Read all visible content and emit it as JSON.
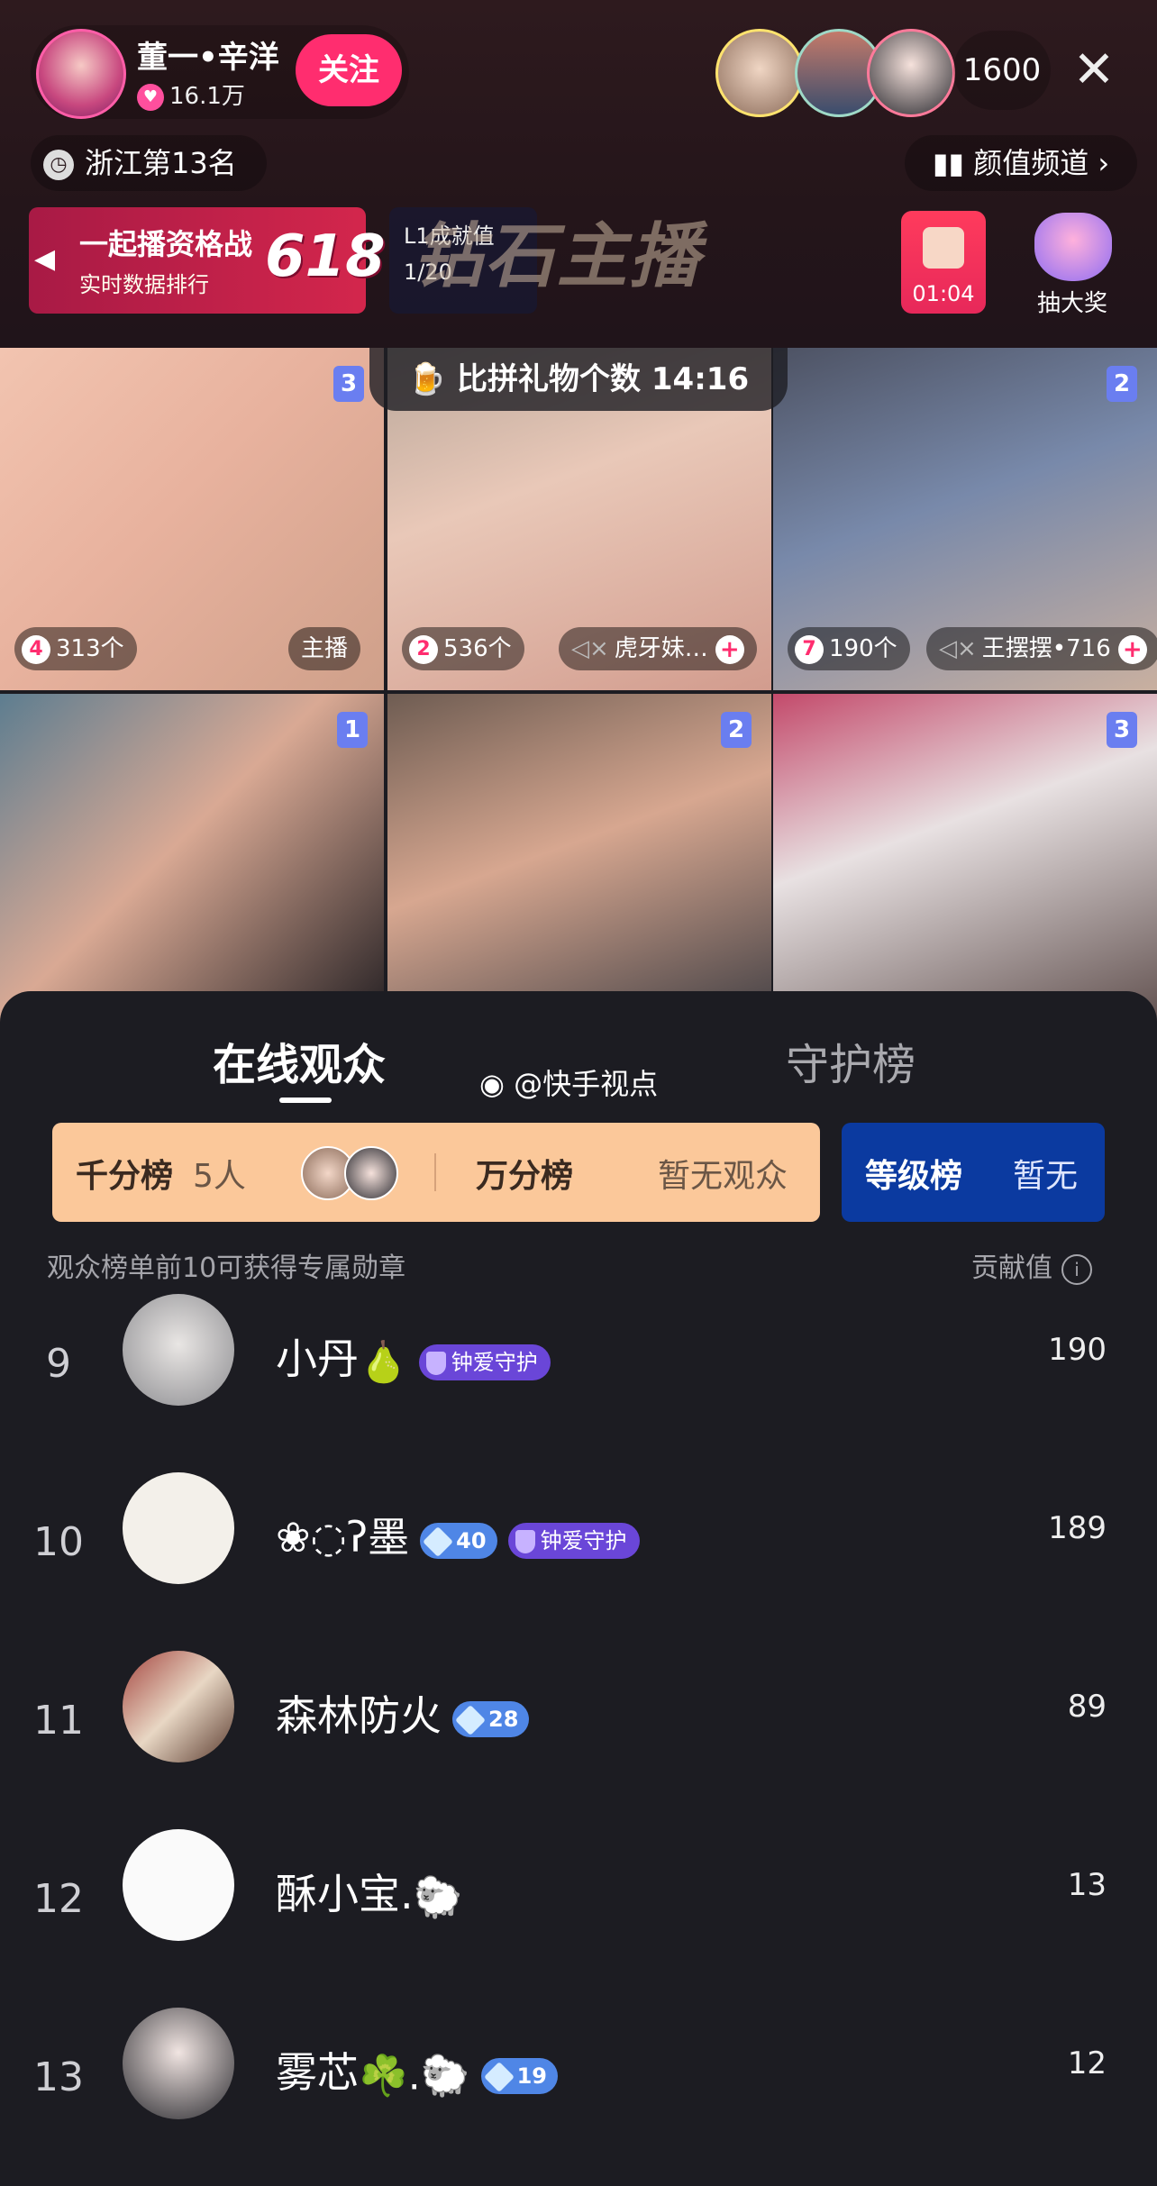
{
  "header": {
    "host_name": "董一•辛洋",
    "host_likes": "16.1万",
    "follow_label": "关注",
    "viewer_count": "1600",
    "close_icon": "close-icon",
    "rank_text": "浙江第13名",
    "channel_text": "颜值频道 ›"
  },
  "banners": {
    "event_title": "一起播资格战",
    "event_sub": "实时数据排行",
    "event_badge": "618",
    "level_name": "L1成就值",
    "level_progress": "1/20",
    "diamond_title": "钻石主播",
    "timer": "01:04",
    "lottery": "抽大奖"
  },
  "pk": {
    "label": "比拼礼物个数",
    "time": "14:16"
  },
  "grid": [
    {
      "badge": "3",
      "rank": "4",
      "count": "313个",
      "name": "主播"
    },
    {
      "badge": "",
      "rank": "2",
      "count": "536个",
      "name": "虎牙妹…"
    },
    {
      "badge": "2",
      "rank": "7",
      "count": "190个",
      "name": "王摆摆•716"
    },
    {
      "badge": "1"
    },
    {
      "badge": "2"
    },
    {
      "badge": "3"
    }
  ],
  "sheet": {
    "tab_online": "在线观众",
    "tab_guard": "守护榜",
    "watermark": "@快手视点",
    "score_label": "千分榜",
    "score_count": "5人",
    "wan_label": "万分榜",
    "wan_value": "暂无观众",
    "level_label": "等级榜",
    "level_value": "暂无",
    "hint": "观众榜单前10可获得专属勋章",
    "contrib": "贡献值"
  },
  "audience": [
    {
      "rank": "9",
      "name": "小丹",
      "emoji": "🍐",
      "gem": "",
      "guard": "钟爱守护",
      "value": "190"
    },
    {
      "rank": "10",
      "name": "❀◌ʔ墨",
      "emoji": "",
      "gem": "40",
      "guard": "钟爱守护",
      "value": "189"
    },
    {
      "rank": "11",
      "name": "森林防火",
      "emoji": "",
      "gem": "28",
      "guard": "",
      "value": "89"
    },
    {
      "rank": "12",
      "name": "酥小宝.",
      "emoji": "🐑",
      "gem": "",
      "guard": "",
      "value": "13"
    },
    {
      "rank": "13",
      "name": "雾芯",
      "emoji": "☘️.🐑",
      "gem": "19",
      "guard": "",
      "value": "12"
    }
  ],
  "colors": {
    "accent_pink": "#ff2d6f",
    "score_bar": "#fbc89a",
    "level_bar": "#0b3aa0",
    "guard_purple": "#6a46d8"
  }
}
